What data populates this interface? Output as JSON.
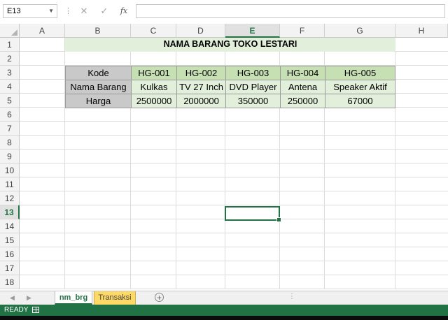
{
  "formula_bar": {
    "name_box": "E13",
    "cancel_glyph": "✕",
    "enter_glyph": "✓",
    "fx_label": "fx",
    "formula_value": ""
  },
  "columns": [
    "A",
    "B",
    "C",
    "D",
    "E",
    "F",
    "G",
    "H"
  ],
  "active_column": "E",
  "rows": [
    "1",
    "2",
    "3",
    "4",
    "5",
    "6",
    "7",
    "8",
    "9",
    "10",
    "11",
    "12",
    "13",
    "14",
    "15",
    "16",
    "17",
    "18"
  ],
  "active_row": "13",
  "sheet": {
    "title": "NAMA BARANG TOKO LESTARI",
    "table": {
      "header_row": [
        "Kode",
        "HG-001",
        "HG-002",
        "HG-003",
        "HG-004",
        "HG-005"
      ],
      "rows": [
        [
          "Nama Barang",
          "Kulkas",
          "TV 27 Inch",
          "DVD Player",
          "Antena",
          "Speaker Aktif"
        ],
        [
          "Harga",
          "2500000",
          "2000000",
          "350000",
          "250000",
          "67000"
        ]
      ]
    }
  },
  "sheet_tabs": [
    "nm_brg",
    "Transaksi"
  ],
  "active_tab": "nm_brg",
  "status": {
    "ready": "READY"
  },
  "colors": {
    "excel_green": "#217346",
    "title_fill": "#e2efda",
    "code_fill": "#c6e0b4",
    "label_fill": "#c9c9c9",
    "transaksi_tab": "#ffd966"
  },
  "icons": [
    "name-box-dropdown-icon",
    "cancel-icon",
    "enter-icon",
    "insert-function-icon",
    "prev-sheet-icon",
    "next-sheet-icon",
    "add-sheet-icon",
    "macro-record-icon"
  ]
}
